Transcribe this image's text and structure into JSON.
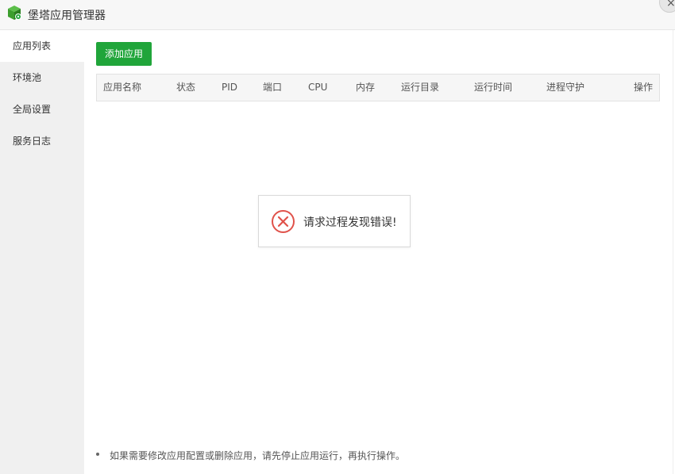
{
  "window": {
    "title": "堡塔应用管理器",
    "close_label": "×"
  },
  "sidebar": {
    "items": [
      {
        "label": "应用列表",
        "active": true
      },
      {
        "label": "环境池",
        "active": false
      },
      {
        "label": "全局设置",
        "active": false
      },
      {
        "label": "服务日志",
        "active": false
      }
    ]
  },
  "toolbar": {
    "add_label": "添加应用"
  },
  "table": {
    "columns": [
      "应用名称",
      "状态",
      "PID",
      "端口",
      "CPU",
      "内存",
      "运行目录",
      "运行时间",
      "进程守护",
      "操作"
    ],
    "rows": []
  },
  "error": {
    "message": "请求过程发现错误!",
    "icon": "error-circle-x-icon",
    "color": "#e0524a"
  },
  "tip": {
    "text": "如果需要修改应用配置或删除应用，请先停止应用运行，再执行操作。"
  },
  "colors": {
    "accent": "#20a53a",
    "sidebar_bg": "#f0f0f0",
    "header_bg": "#f6f6f6"
  }
}
